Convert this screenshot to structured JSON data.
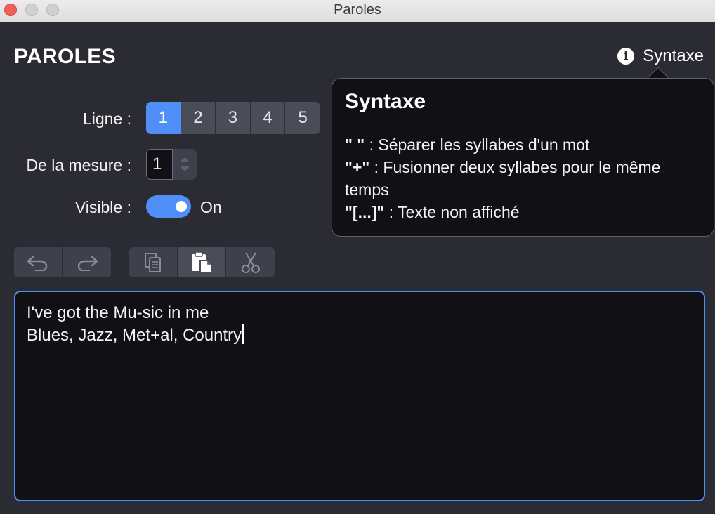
{
  "window": {
    "title": "Paroles"
  },
  "panel": {
    "title": "PAROLES"
  },
  "syntax_link": {
    "label": "Syntaxe",
    "icon": "info-icon"
  },
  "ligne": {
    "label": "Ligne :",
    "options": [
      "1",
      "2",
      "3",
      "4",
      "5"
    ],
    "selected": "1"
  },
  "mesure": {
    "label": "De la mesure :",
    "value": "1"
  },
  "visible": {
    "label": "Visible :",
    "state": "On"
  },
  "toolbar": {
    "icons": [
      "undo-icon",
      "redo-icon",
      "copy-icon",
      "paste-icon",
      "cut-icon"
    ]
  },
  "editor": {
    "lines": [
      "I've got the Mu-sic in me",
      "Blues, Jazz, Met+al, Country"
    ]
  },
  "popover": {
    "title": "Syntaxe",
    "items": [
      {
        "key": "\" \"",
        "desc": " : Séparer les syllabes d'un mot"
      },
      {
        "key": "\"+\"",
        "desc": " : Fusionner deux syllabes pour le même temps"
      },
      {
        "key": "\"[...]\"",
        "desc": " : Texte non affiché"
      }
    ]
  },
  "colors": {
    "accent": "#4f8ff7",
    "background": "#2b2b33",
    "editor_bg": "#101015",
    "close_button": "#ee5f57"
  }
}
